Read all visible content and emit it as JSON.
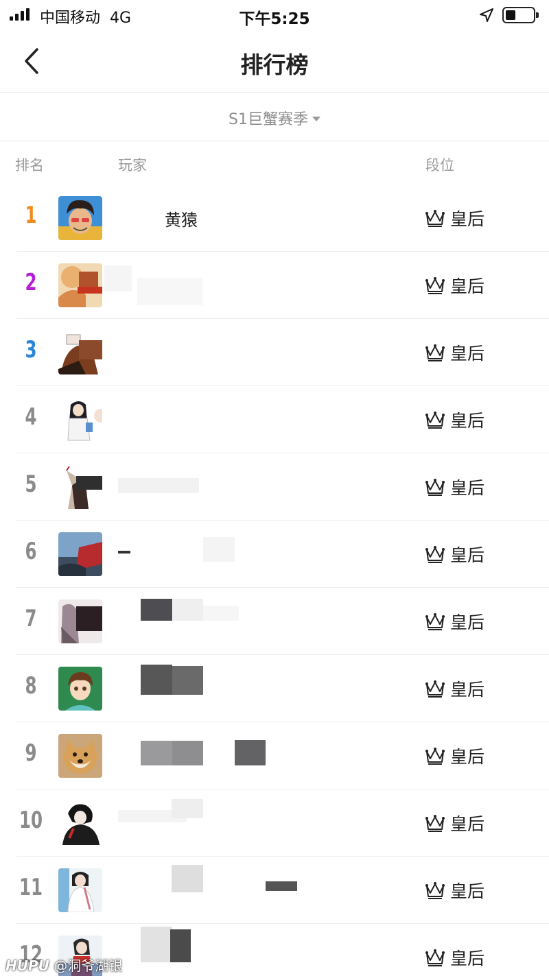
{
  "status_bar": {
    "carrier": "中国移动",
    "network": "4G",
    "time": "下午5:25"
  },
  "nav": {
    "title": "排行榜"
  },
  "season_selector": {
    "value": "S1巨蟹赛季"
  },
  "table_header": {
    "rank": "排名",
    "player": "玩家",
    "tier": "段位"
  },
  "rows": [
    {
      "rank": "1",
      "name": "黄猿",
      "tier": "皇后",
      "rank_color": "#f08c1c"
    },
    {
      "rank": "2",
      "name": "",
      "tier": "皇后",
      "rank_color": "#b51fd8"
    },
    {
      "rank": "3",
      "name": "",
      "tier": "皇后",
      "rank_color": "#2a86d8"
    },
    {
      "rank": "4",
      "name": "",
      "tier": "皇后"
    },
    {
      "rank": "5",
      "name": "",
      "tier": "皇后"
    },
    {
      "rank": "6",
      "name": "",
      "tier": "皇后"
    },
    {
      "rank": "7",
      "name": "",
      "tier": "皇后"
    },
    {
      "rank": "8",
      "name": "",
      "tier": "皇后"
    },
    {
      "rank": "9",
      "name": "",
      "tier": "皇后"
    },
    {
      "rank": "10",
      "name": "",
      "tier": "皇后"
    },
    {
      "rank": "11",
      "name": "",
      "tier": "皇后"
    },
    {
      "rank": "12",
      "name": "",
      "tier": "皇后"
    }
  ],
  "watermark": {
    "brand": "HUPU",
    "handle": "@洞爷湖银"
  },
  "icons": {
    "back": "chevron-left-icon",
    "tier": "crown-icon",
    "location": "location-arrow-icon",
    "dropdown": "caret-down-icon"
  }
}
